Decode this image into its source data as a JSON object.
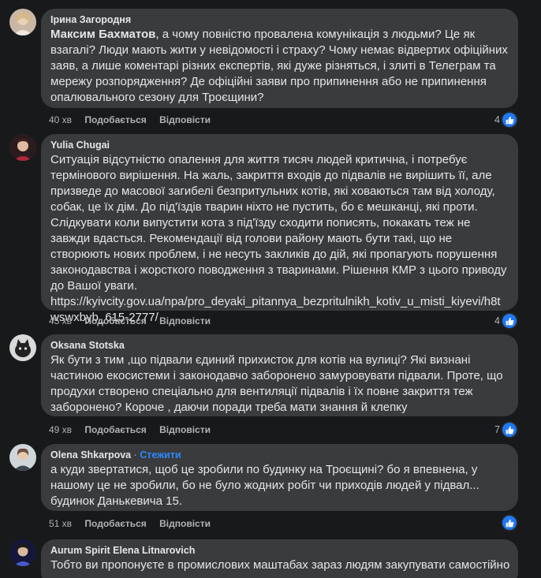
{
  "comments": [
    {
      "author": "Ірина Загородня",
      "mention": "Максим Бахматов",
      "text": ", а чому повністю провалена комунікація з людьми? Це як взагалі? Люди мають жити у невідомості і страху? Чому немає відвертих офіційних заяв, а лише коментарі різних експертів, які дуже різняться, і злиті в Телеграм та мережу розпорядження? Де офіційні заяви про припинення або не припинення опалювального сезону для Троєщини?",
      "time": "40 хв",
      "like_label": "Подобається",
      "reply_label": "Відповісти",
      "reactions": "4",
      "avatar_icon": "user-photo-avatar"
    },
    {
      "author": "Yulia Chugai",
      "text": "Ситуація відсутністю опалення для життя тисяч людей критична, і потребує термінового вирішення. На жаль, закриття входів до підвалів не вирішить її, але призведе до масової загибелі безпритульних котів, які ховаються там від холоду, собак, це їх дім. До під'їздів тварин ніхто не пустить, бо є мешканці, які проти. Слідкувати коли випустити кота з під'їзду сходити пописять, покакать теж не завжди вдасться. Рекомендації від голови району мають бути такі, що не створюють нових проблем, і не несуть закликів до дій, які пропагують порушення законодавства і жорсткого поводження з тваринами. Рішення КМР з цього приводу до Вашої уваги.",
      "link": "https://kyivcity.gov.ua/npa/pro_deyaki_pitannya_bezpritulnikh_kotiv_u_misti_kiyevi/h8twswxbyb_615-2777/",
      "time": "45 хв",
      "like_label": "Подобається",
      "reply_label": "Відповісти",
      "reactions": "4",
      "avatar_icon": "user-photo-avatar"
    },
    {
      "author": "Oksana Stotska",
      "text": "Як бути з тим ,що підвали єдиний прихисток для котів на вулиці? Які визнані частиною екосистеми і законодавчо заборонено замуровувати підвали. Проте, що продухи створено спеціально для вентиляції підвалів і їх повне закриття теж заборонено? Короче , даючи поради треба мати знання й клепку",
      "time": "49 хв",
      "like_label": "Подобається",
      "reply_label": "Відповісти",
      "reactions": "7",
      "avatar_icon": "cat-photo-avatar"
    },
    {
      "author": "Olena Shkarpova",
      "follow_label": "Стежити",
      "text": "а куди звертатися, щоб це зробили по будинку на Троєщині? бо я впевнена, у нашому це не зробили, бо не було жодних робіт чи приходів людей у підвал... будинок Данькевича 15.",
      "time": "51 хв",
      "like_label": "Подобається",
      "reply_label": "Відповісти",
      "reactions": "",
      "avatar_icon": "user-photo-avatar"
    },
    {
      "author": "Aurum Spirit Elena Litnarovich",
      "text": "Тобто ви пропонуєте в промислових маштабах зараз людям закупувати самостійно",
      "avatar_icon": "user-photo-avatar"
    }
  ],
  "colors": {
    "background": "#18191a",
    "bubble": "#3a3b3c",
    "text": "#e4e6eb",
    "secondary_text": "#b0b3b8",
    "like_blue": "#2078f4",
    "follow_link": "#2d88ff"
  }
}
